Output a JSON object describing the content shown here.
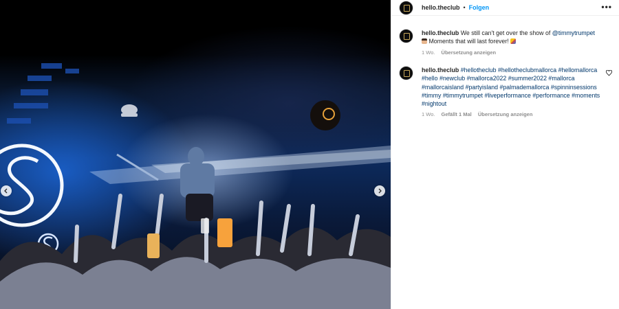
{
  "post": {
    "username": "hello.theclub",
    "separator": "•",
    "follow_label": "Folgen",
    "more_icon": "more-horizontal-icon",
    "more_label": "•••"
  },
  "caption": {
    "username": "hello.theclub",
    "text_before": "We still can't get over the show of",
    "mention": "@timmytrumpet",
    "text_after": "Moments that will last forever!",
    "emoji_1": "person-raising-hand-emoji",
    "emoji_2": "party-popper-emoji",
    "age": "1 Wo.",
    "translate_label": "Übersetzung anzeigen"
  },
  "comment": {
    "username": "hello.theclub",
    "hashtags": [
      "#hellotheclub",
      "#hellotheclubmallorca",
      "#hellomallorca",
      "#hello",
      "#newclub",
      "#mallorca2022",
      "#summer2022",
      "#mallorca",
      "#mallorcaisland",
      "#partyisland",
      "#palmademallorca",
      "#spinninsessions",
      "#timmy",
      "#timmytrumpet",
      "#liveperformance",
      "#performance",
      "#moments",
      "#nightout"
    ],
    "age": "1 Wo.",
    "likes_label": "Gefällt 1 Mal",
    "translate_label": "Übersetzung anzeigen",
    "like_icon": "heart-icon"
  },
  "media": {
    "prev_icon": "chevron-left-icon",
    "next_icon": "chevron-right-icon",
    "logo_icon": "spinnin-logo-icon"
  },
  "colors": {
    "accent": "#0095f6",
    "link": "#00376b",
    "meta": "#8e8e8e",
    "text": "#262626"
  }
}
